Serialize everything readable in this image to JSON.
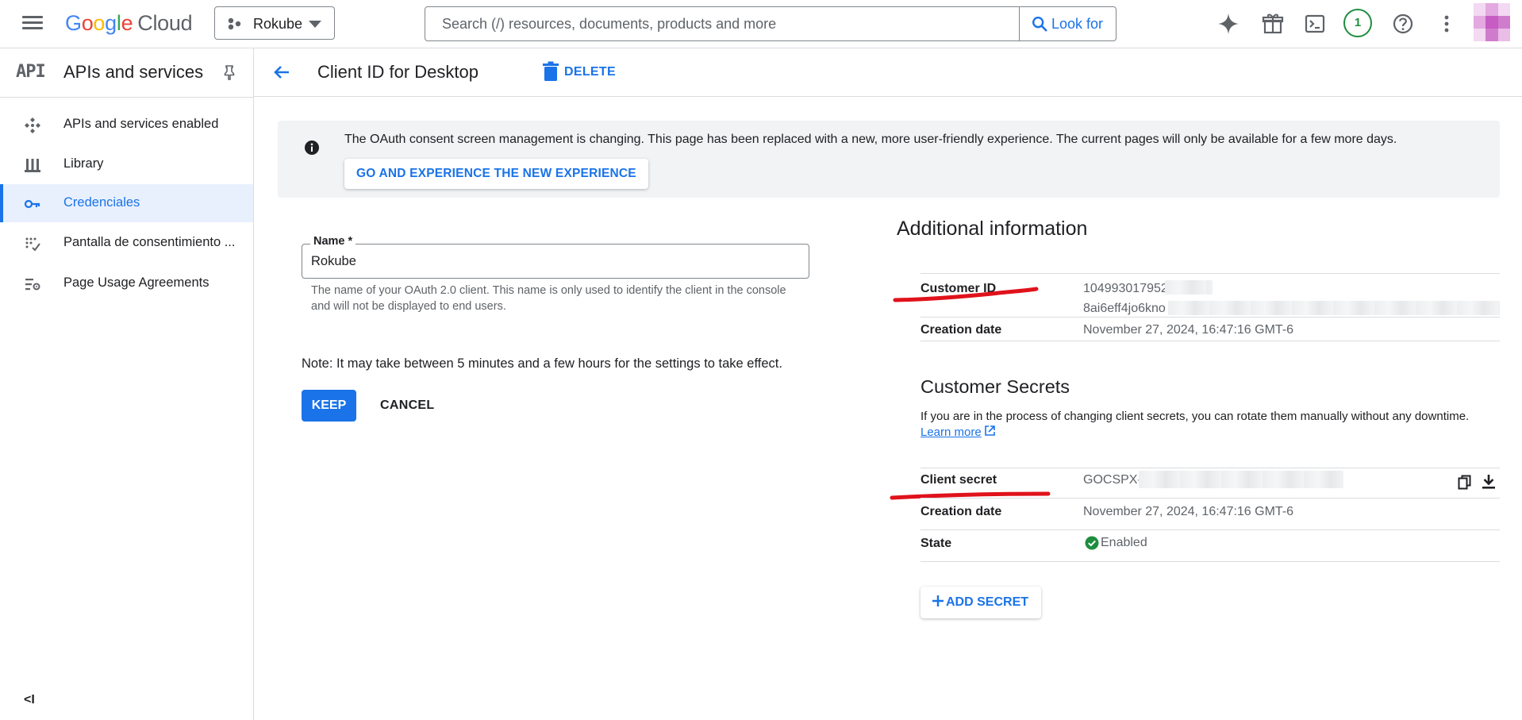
{
  "header": {
    "logo": {
      "google": "Google",
      "cloud": "Cloud"
    },
    "project_name": "Rokube",
    "search_placeholder": "Search (/) resources, documents, products and more",
    "search_button": "Look for",
    "notifications_count": "1"
  },
  "sidebar": {
    "api_logo": "API",
    "title": "APIs and services",
    "items": [
      {
        "label": "APIs and services enabled",
        "icon": "hub-icon"
      },
      {
        "label": "Library",
        "icon": "library-icon"
      },
      {
        "label": "Credenciales",
        "icon": "key-icon"
      },
      {
        "label": "Pantalla de consentimiento ...",
        "icon": "consent-icon"
      },
      {
        "label": "Page Usage Agreements",
        "icon": "settings-list-icon"
      }
    ],
    "collapse_label": "<I"
  },
  "subheader": {
    "title": "Client ID for Desktop",
    "delete_label": "DELETE"
  },
  "banner": {
    "message": "The OAuth consent screen management is changing. This page has been replaced with a new, more user-friendly experience. The current pages will only be available for a few more days.",
    "button": "GO AND EXPERIENCE THE NEW EXPERIENCE"
  },
  "form": {
    "name_label": "Name *",
    "name_value": "Rokube",
    "helper": "The name of your OAuth 2.0 client. This name is only used to identify the client in the console and will not be displayed to end users.",
    "note": "Note: It may take between 5 minutes and a few hours for the settings to take effect.",
    "keep": "KEEP",
    "cancel": "CANCEL"
  },
  "additional_info": {
    "heading": "Additional information",
    "customer_id_key": "Customer ID",
    "customer_id_line1": "104993017952",
    "customer_id_line2": "8ai6eff4jo6kno",
    "creation_date_key": "Creation date",
    "creation_date_value": "November 27, 2024, 16:47:16 GMT-6"
  },
  "secrets": {
    "heading": "Customer Secrets",
    "description": "If you are in the process of changing client secrets, you can rotate them manually without any downtime.",
    "learn_more": "Learn more",
    "client_secret_key": "Client secret",
    "client_secret_value": "GOCSPX-1",
    "creation_date_key": "Creation date",
    "creation_date_value": "November 27, 2024, 16:47:16 GMT-6",
    "state_key": "State",
    "state_value": "Enabled",
    "add_secret": "ADD SECRET"
  },
  "colors": {
    "accent": "#1a73e8",
    "success": "#1e8e3e",
    "annotation_red": "#e0121b"
  }
}
